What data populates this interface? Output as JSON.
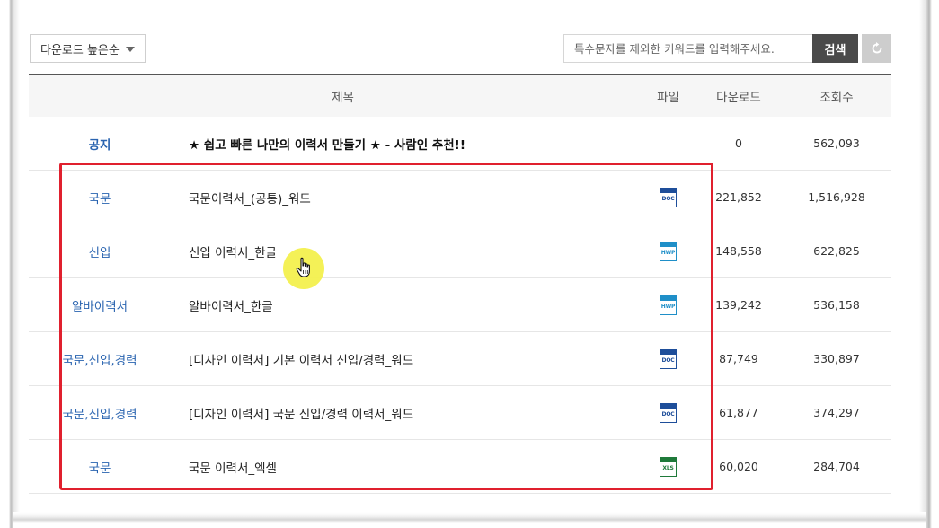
{
  "toolbar": {
    "sort_label": "다운로드 높은순",
    "search_placeholder": "특수문자를 제외한 키워드를 입력해주세요.",
    "search_value": "",
    "search_button": "검색",
    "reset_icon": "refresh-icon"
  },
  "table": {
    "headers": {
      "title": "제목",
      "file": "파일",
      "downloads": "다운로드",
      "views": "조회수"
    },
    "notice": {
      "category": "공지",
      "title": "★ 쉽고 빠른 나만의 이력서 만들기 ★ - 사람인 추천!!",
      "downloads": "0",
      "views": "562,093"
    },
    "rows": [
      {
        "category": "국문",
        "title": "국문이력서_(공통)_워드",
        "file": "DOC",
        "downloads": "221,852",
        "views": "1,516,928"
      },
      {
        "category": "신입",
        "title": "신입 이력서_한글",
        "file": "HWP",
        "downloads": "148,558",
        "views": "622,825"
      },
      {
        "category": "알바이력서",
        "title": "알바이력서_한글",
        "file": "HWP",
        "downloads": "139,242",
        "views": "536,158"
      },
      {
        "category": "국문,신입,경력",
        "title": "[디자인 이력서] 기본 이력서 신입/경력_워드",
        "file": "DOC",
        "downloads": "87,749",
        "views": "330,897"
      },
      {
        "category": "국문,신입,경력",
        "title": "[디자인 이력서] 국문 신입/경력 이력서_워드",
        "file": "DOC",
        "downloads": "61,877",
        "views": "374,297"
      },
      {
        "category": "국문",
        "title": "국문 이력서_엑셀",
        "file": "XLS",
        "downloads": "60,020",
        "views": "284,704"
      }
    ]
  },
  "file_colors": {
    "DOC": "#1e4e9a",
    "HWP": "#1f8fc8",
    "XLS": "#1f7a3a"
  },
  "accent": {
    "category_link": "#2a64b0",
    "highlight": "#e0202e",
    "cursor_halo": "#f3f04e",
    "search_button_bg": "#4a4a4a"
  }
}
